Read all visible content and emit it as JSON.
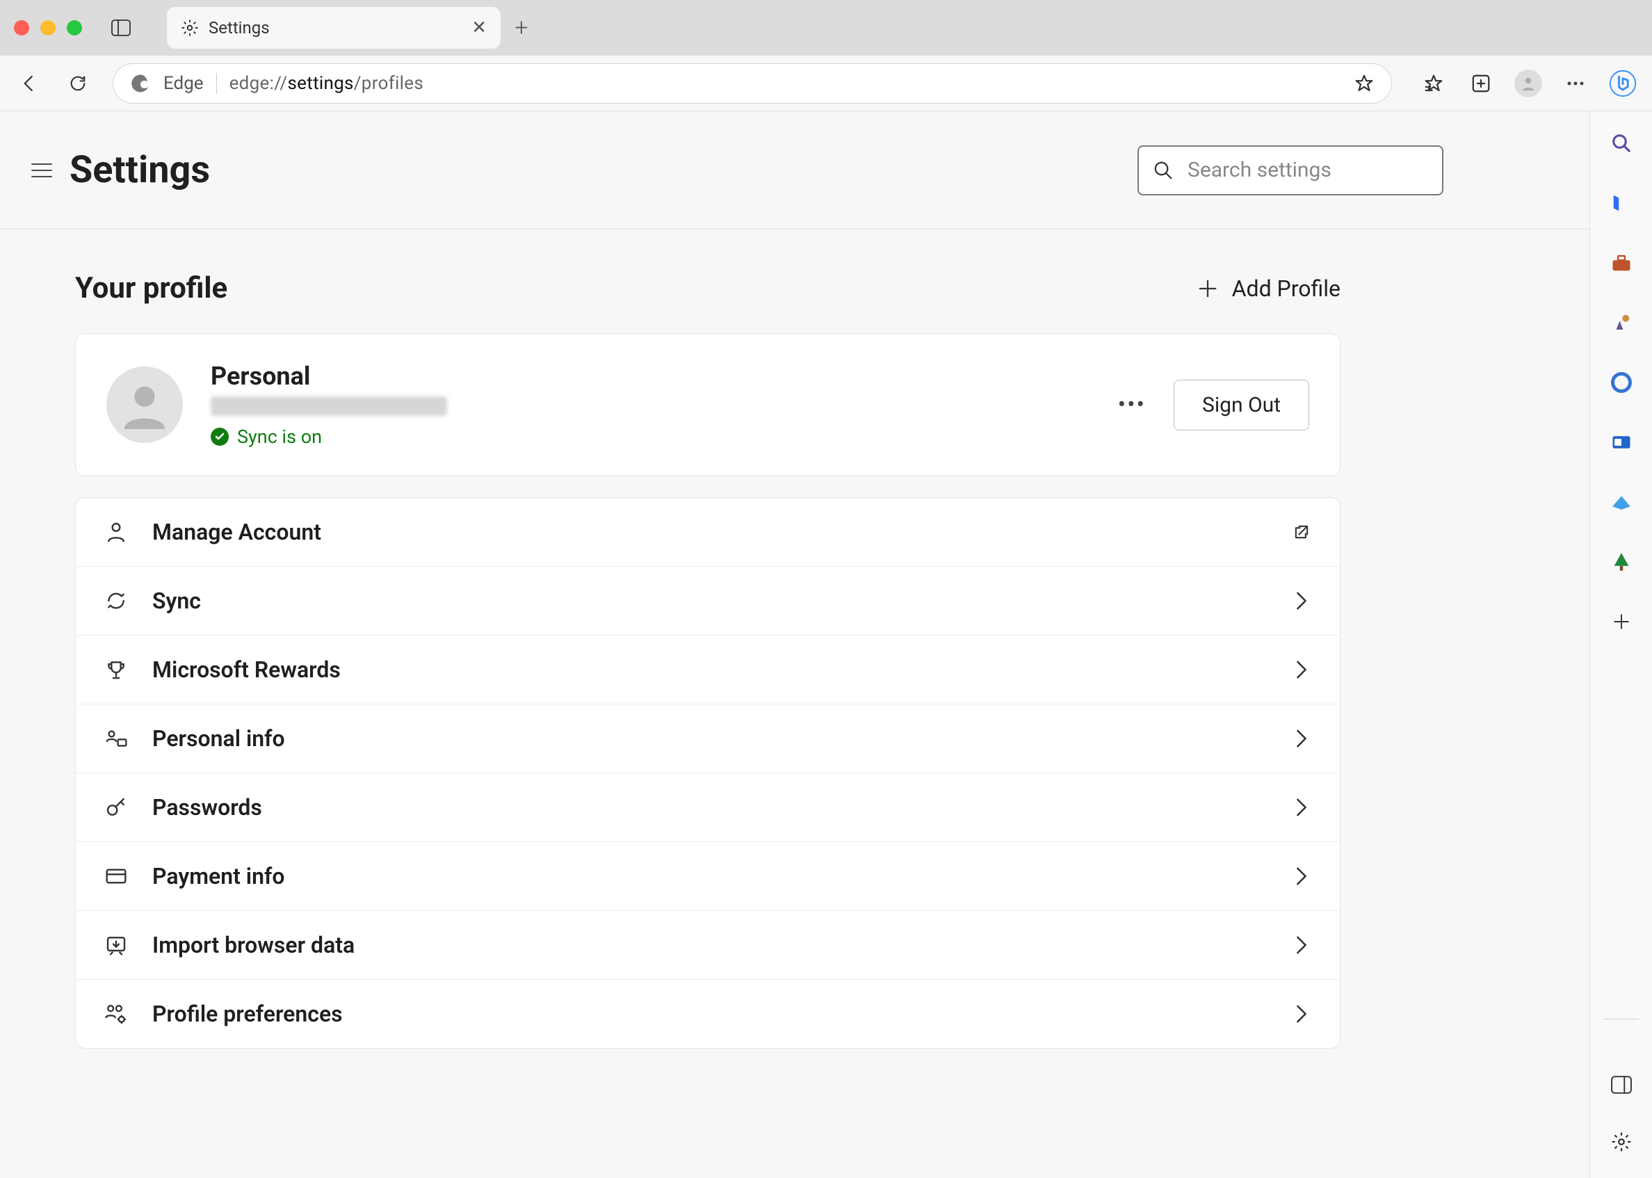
{
  "tab": {
    "title": "Settings"
  },
  "urlbar": {
    "engine_label": "Edge",
    "prefix": "edge://",
    "path_bold": "settings",
    "path_rest": "/profiles"
  },
  "header": {
    "title": "Settings",
    "search_placeholder": "Search settings"
  },
  "section": {
    "title": "Your profile",
    "add_label": "Add Profile"
  },
  "profile": {
    "name": "Personal",
    "sync_status": "Sync is on",
    "signout_label": "Sign Out"
  },
  "options": [
    {
      "label": "Manage Account",
      "action": "external"
    },
    {
      "label": "Sync",
      "action": "nav"
    },
    {
      "label": "Microsoft Rewards",
      "action": "nav"
    },
    {
      "label": "Personal info",
      "action": "nav"
    },
    {
      "label": "Passwords",
      "action": "nav"
    },
    {
      "label": "Payment info",
      "action": "nav"
    },
    {
      "label": "Import browser data",
      "action": "nav"
    },
    {
      "label": "Profile preferences",
      "action": "nav"
    }
  ]
}
